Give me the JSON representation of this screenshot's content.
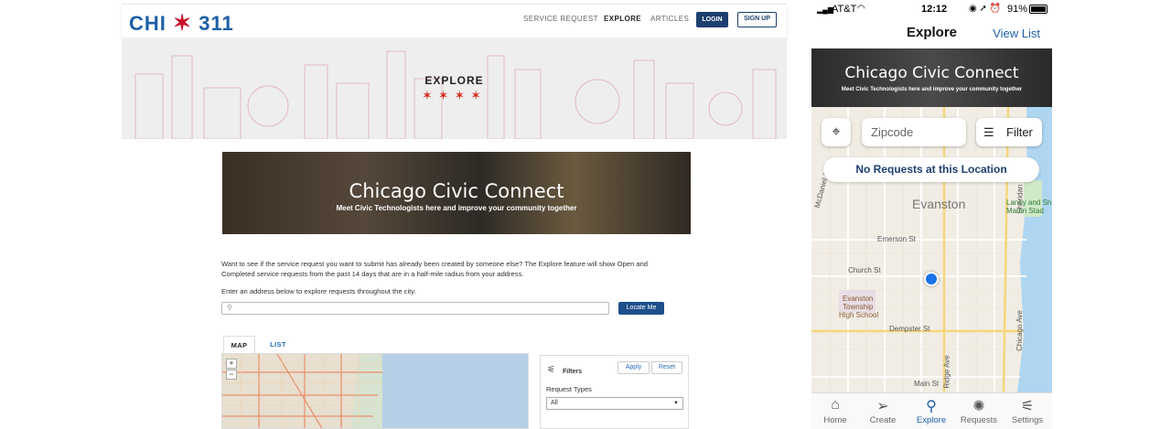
{
  "web": {
    "logo": {
      "left": "CHI",
      "right": "311"
    },
    "nav": [
      "SERVICE REQUEST",
      "EXPLORE",
      "ARTICLES"
    ],
    "login": "LOGIN",
    "signup": "SIGN UP",
    "hero_title": "EXPLORE",
    "hero_stars": "✶✶✶✶",
    "banner_title": "Chicago Civic Connect",
    "banner_subtitle": "Meet Civic Technologists here and improve your community together",
    "intro_line1": "Want to see if the service request you want to submit has already been created by someone else? The Explore feature will show Open and",
    "intro_line2": "Completed service requests from the past 14 days that are in a half-mile radius from your address.",
    "intro_line3": "Enter an address below to explore requests throughout the city.",
    "search_placeholder": "",
    "locate_button": "Locate Me",
    "tabs": {
      "map": "MAP",
      "list": "LIST"
    },
    "zoom_in": "+",
    "zoom_out": "−",
    "filters": {
      "label": "Filters",
      "apply": "Apply",
      "reset": "Reset",
      "request_types_label": "Request Types",
      "request_types_value": "All"
    }
  },
  "mobile": {
    "status": {
      "carrier": "AT&T",
      "time": "12:12",
      "battery": "91%"
    },
    "title": "Explore",
    "view_list": "View List",
    "banner_title": "Chicago Civic Connect",
    "banner_subtitle": "Meet Civic Technologists here and improve your community together",
    "zip_placeholder": "Zipcode",
    "filter_label": "Filter",
    "no_requests": "No Requests at this Location",
    "map_labels": {
      "evanston": "Evanston",
      "emerson": "Emerson St",
      "church": "Church St",
      "school1": "Evanston",
      "school2": "Township",
      "school3": "High School",
      "dempster": "Dempster St",
      "main": "Main St",
      "chicago_ave": "Chicago Ave",
      "ridge": "Ridge Ave",
      "sheridan": "Sheridan Rd",
      "lanny1": "Lanny and Sh",
      "lanny2": "Martin Stad",
      "mcdaniel": "McDaniel Ave"
    },
    "tabs": [
      "Home",
      "Create",
      "Explore",
      "Requests",
      "Settings"
    ]
  }
}
